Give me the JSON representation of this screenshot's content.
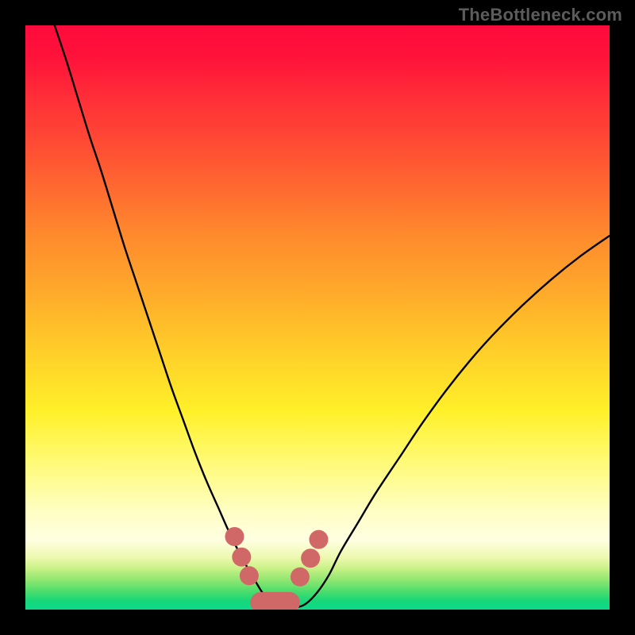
{
  "watermark": "TheBottleneck.com",
  "chart_data": {
    "type": "line",
    "title": "",
    "xlabel": "",
    "ylabel": "",
    "xlim": [
      0,
      100
    ],
    "ylim": [
      0,
      100
    ],
    "gradient_stops": [
      {
        "pct": 0,
        "color": "#ff0a3c"
      },
      {
        "pct": 20,
        "color": "#ff4a34"
      },
      {
        "pct": 46,
        "color": "#ffab2b"
      },
      {
        "pct": 66,
        "color": "#fff029"
      },
      {
        "pct": 88,
        "color": "#ffffe2"
      },
      {
        "pct": 95,
        "color": "#8de670"
      },
      {
        "pct": 100,
        "color": "#0cd98a"
      }
    ],
    "series": [
      {
        "name": "bottleneck-curve",
        "x": [
          5,
          7,
          9,
          11,
          13,
          15,
          17,
          19,
          21,
          23,
          25,
          27,
          29,
          31,
          33,
          35,
          37,
          39,
          40.5,
          42,
          44,
          46,
          48,
          50,
          52,
          54,
          57,
          60,
          64,
          68,
          72,
          76,
          80,
          85,
          90,
          95,
          100
        ],
        "y": [
          100,
          94,
          87.5,
          81,
          75,
          68.5,
          62,
          56,
          50,
          44,
          38,
          32.5,
          27,
          22,
          17.5,
          13,
          9,
          5.5,
          3,
          1,
          0.3,
          0.3,
          1,
          3,
          6,
          10,
          15,
          20,
          26,
          32,
          37.5,
          42.5,
          47,
          52,
          56.5,
          60.5,
          64
        ]
      }
    ],
    "markers": {
      "name": "highlight-dots",
      "color": "#d06868",
      "points": [
        {
          "x": 35.8,
          "y": 12.5
        },
        {
          "x": 37.0,
          "y": 9.0
        },
        {
          "x": 38.3,
          "y": 5.8
        },
        {
          "x": 47.0,
          "y": 5.6
        },
        {
          "x": 48.8,
          "y": 8.8
        },
        {
          "x": 50.2,
          "y": 12.0
        }
      ]
    },
    "trough_band": {
      "name": "trough-band",
      "color": "#d06868",
      "x_start": 38.5,
      "x_end": 47.0,
      "y": 1.2,
      "thickness_pct": 3.6
    }
  }
}
